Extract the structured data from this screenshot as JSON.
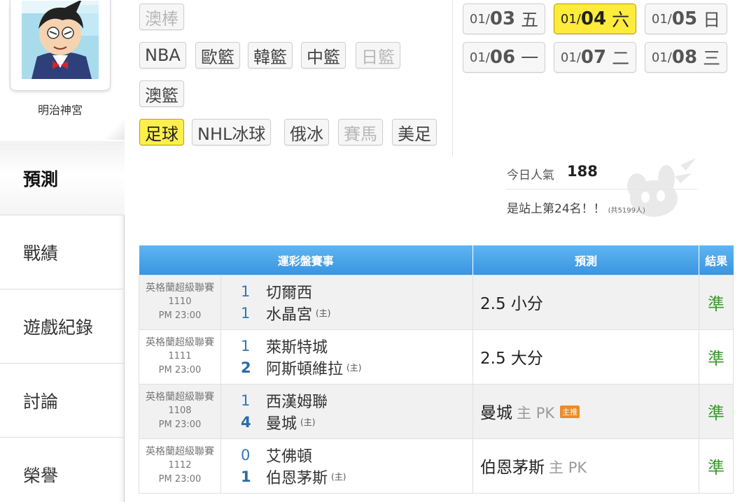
{
  "user": {
    "name": "明治神宮"
  },
  "nav": [
    {
      "label": "預測",
      "active": true
    },
    {
      "label": "戰績"
    },
    {
      "label": "遊戲紀錄"
    },
    {
      "label": "討論"
    },
    {
      "label": "榮譽"
    }
  ],
  "categories": {
    "row1": [
      {
        "label": "澳棒",
        "disabled": true
      }
    ],
    "row2": [
      {
        "label": "NBA"
      },
      {
        "label": "歐籃"
      },
      {
        "label": "韓籃"
      },
      {
        "label": "中籃"
      },
      {
        "label": "日籃",
        "disabled": true
      }
    ],
    "row3": [
      {
        "label": "澳籃"
      }
    ],
    "row4": [
      {
        "label": "足球",
        "active": true
      },
      {
        "label": "NHL冰球"
      },
      {
        "label": "俄冰"
      },
      {
        "label": "賽馬",
        "disabled": true
      },
      {
        "label": "美足"
      }
    ]
  },
  "dates": [
    {
      "month": "01/",
      "day": "03",
      "weekday": "五"
    },
    {
      "month": "01/",
      "day": "04",
      "weekday": "六",
      "active": true
    },
    {
      "month": "01/",
      "day": "05",
      "weekday": "日"
    },
    {
      "month": "01/",
      "day": "06",
      "weekday": "一"
    },
    {
      "month": "01/",
      "day": "07",
      "weekday": "二"
    },
    {
      "month": "01/",
      "day": "08",
      "weekday": "三"
    }
  ],
  "popularity": {
    "label": "今日人氣",
    "value": "188",
    "rank_text": "是站上第24名！！",
    "total_text": "(共5199人)"
  },
  "table": {
    "headers": {
      "event": "運彩盤賽事",
      "prediction": "預測",
      "result": "結果"
    },
    "home_marker": "(主)",
    "rows": [
      {
        "league": "英格蘭超級聯賽",
        "code": "1110",
        "time": "PM 23:00",
        "away": {
          "score": "1",
          "name": "切爾西"
        },
        "home": {
          "score": "1",
          "name": "水晶宮"
        },
        "prediction": "2.5 小分",
        "prediction_sub": "",
        "badge": "",
        "result": "準"
      },
      {
        "league": "英格蘭超級聯賽",
        "code": "1111",
        "time": "PM 23:00",
        "away": {
          "score": "1",
          "name": "萊斯特城"
        },
        "home": {
          "score": "2",
          "name": "阿斯頓維拉",
          "win": true
        },
        "prediction": "2.5 大分",
        "prediction_sub": "",
        "badge": "",
        "result": "準"
      },
      {
        "league": "英格蘭超級聯賽",
        "code": "1108",
        "time": "PM 23:00",
        "away": {
          "score": "1",
          "name": "西漢姆聯"
        },
        "home": {
          "score": "4",
          "name": "曼城",
          "win": true
        },
        "prediction": "曼城",
        "prediction_sub": "主 PK",
        "badge": "主推",
        "result": "準"
      },
      {
        "league": "英格蘭超級聯賽",
        "code": "1112",
        "time": "PM 23:00",
        "away": {
          "score": "0",
          "name": "艾佛頓"
        },
        "home": {
          "score": "1",
          "name": "伯恩茅斯",
          "win": true
        },
        "prediction": "伯恩茅斯",
        "prediction_sub": "主 PK",
        "badge": "",
        "result": "準"
      }
    ]
  }
}
